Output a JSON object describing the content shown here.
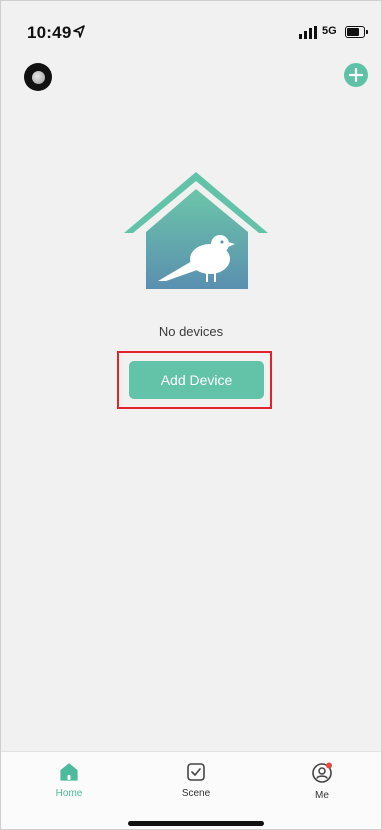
{
  "status_bar": {
    "time": "10:49",
    "network": "5G",
    "location_icon": "location-arrow-icon",
    "signal_icon": "signal-icon",
    "battery_icon": "battery-icon"
  },
  "header": {
    "avatar_icon": "profile-avatar-icon",
    "add_icon": "plus-circle-icon"
  },
  "empty_state": {
    "illustration": "bird-house-icon",
    "message": "No devices",
    "button_label": "Add Device"
  },
  "tabs": [
    {
      "label": "Home",
      "icon": "home-icon",
      "active": true
    },
    {
      "label": "Scene",
      "icon": "scene-checkbox-icon",
      "active": false
    },
    {
      "label": "Me",
      "icon": "user-icon",
      "active": false,
      "badge": true
    }
  ],
  "colors": {
    "accent": "#62c3a8",
    "highlight": "#e0242c",
    "background": "#f1f1f1"
  }
}
